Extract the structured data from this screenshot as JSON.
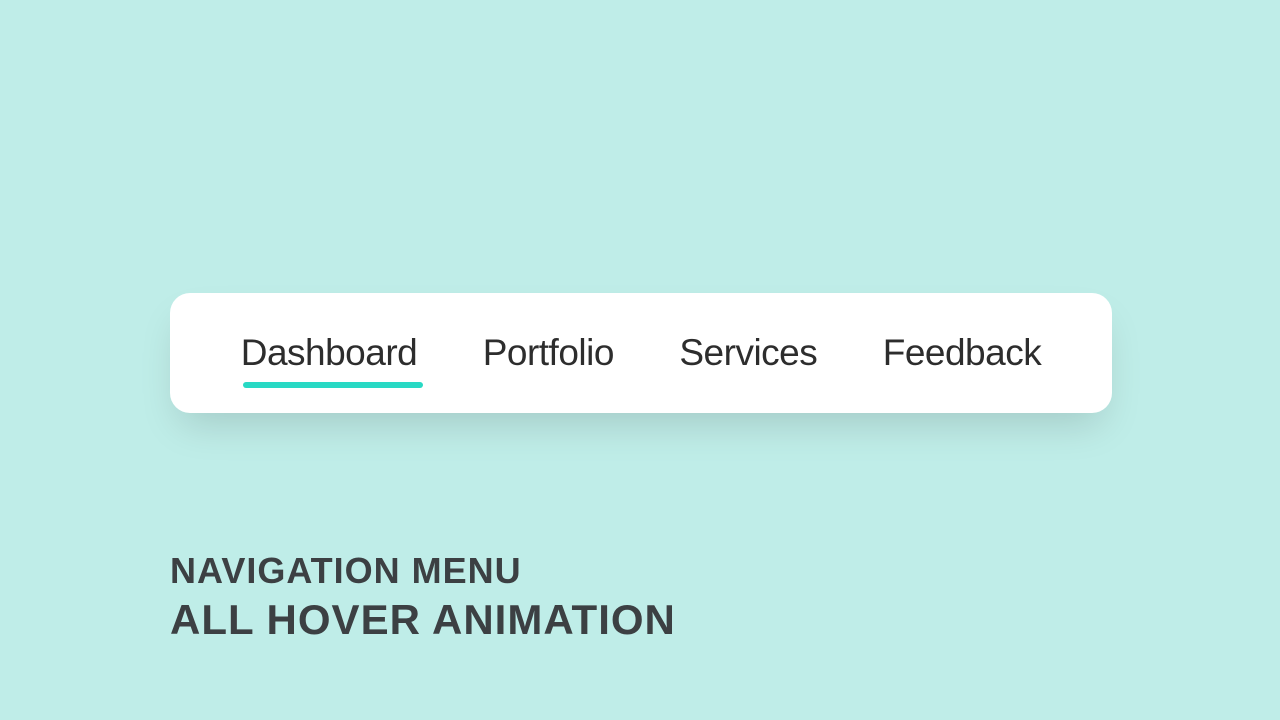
{
  "nav": {
    "items": [
      {
        "label": "Dashboard",
        "active": true
      },
      {
        "label": "Portfolio",
        "active": false
      },
      {
        "label": "Services",
        "active": false
      },
      {
        "label": "Feedback",
        "active": false
      }
    ]
  },
  "caption": {
    "line1": "NAVIGATION MENU",
    "line2": "ALL HOVER ANIMATION"
  },
  "colors": {
    "background": "#bfede8",
    "accent": "#28d9c4",
    "text": "#2d2d2d",
    "caption": "#3c4043"
  }
}
